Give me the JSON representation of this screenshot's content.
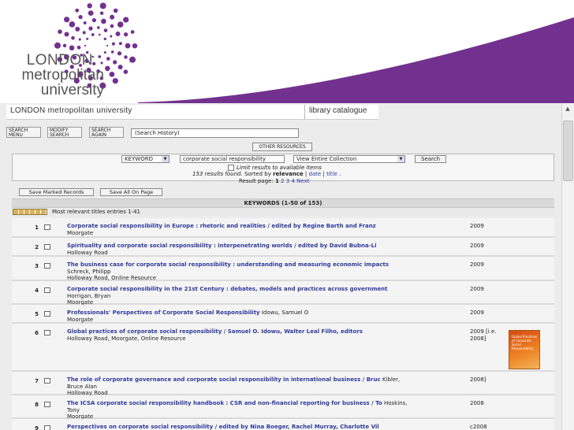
{
  "logo": {
    "line1": "LONDON",
    "line2": "metropolitan",
    "line3": "university",
    "accent": "#73318f"
  },
  "banner": {
    "left": "LONDON metropolitan university",
    "right": "library catalogue"
  },
  "nav": {
    "search_menu": [
      "SEARCH",
      "MENU"
    ],
    "modify_search": [
      "MODIFY",
      "SEARCH"
    ],
    "search_again": [
      "SEARCH",
      "AGAIN"
    ],
    "history": "(Search History)",
    "other_resources": "OTHER RESOURCES"
  },
  "search": {
    "field": "KEYWORD",
    "query": "corporate social responsibility",
    "collection": "View Entire Collection",
    "button": "Search",
    "limit": "Limit results to available items",
    "results_prefix": "153 results found.",
    "sorted_by": "Sorted by",
    "relevance": "relevance",
    "sep1": "|",
    "date": "date",
    "sep2": "|",
    "title": "title",
    "tail": ".",
    "page_label": "Result page:",
    "pages": [
      "1",
      "2",
      "3",
      "4"
    ],
    "next": "Next"
  },
  "actions": {
    "save_marked": "Save Marked Records",
    "save_all": "Save All On Page"
  },
  "keywords_bar": "KEYWORDS (1-50 of 153)",
  "entries_label": "Most relevant titles entries 1-41",
  "results": [
    {
      "num": "1",
      "title": "Corporate social responsibility in Europe : rhetoric and realities / edited by Regine Barth and Franz",
      "author": "",
      "details": [
        "Moorgate"
      ],
      "year": "2009"
    },
    {
      "num": "2",
      "title": "Spirituality and corporate social responsibility : interpenetrating worlds / edited by David Bubna-Li",
      "author": "",
      "details": [
        "Holloway Road"
      ],
      "year": "2009"
    },
    {
      "num": "3",
      "title": "The business case for corporate social responsibility : understanding and measuring economic impacts",
      "author": "",
      "details": [
        "Schreck, Philipp",
        "Holloway Road, Online Resource"
      ],
      "year": "2009"
    },
    {
      "num": "4",
      "title": "Corporate social responsibility in the 21st Century : debates, models and practices across government",
      "author": "",
      "details": [
        "Horrigan, Bryan",
        "Moorgate"
      ],
      "year": "2009"
    },
    {
      "num": "5",
      "title": "Professionals' Perspectives of Corporate Social Responsibility",
      "author": "Idowu, Samuel O",
      "details": [
        "Moorgate"
      ],
      "year": "2009"
    },
    {
      "num": "6",
      "title": "Global practices of corporate social responsibility / Samuel O. Idowu, Walter Leal Filho, editors",
      "author": "",
      "details": [
        "Holloway Road, Moorgate, Online Resource"
      ],
      "year": "2009 [i.e. 2008]",
      "cover": "Global Practices of Corporate Social Responsibility"
    },
    {
      "num": "7",
      "title": "The role of corporate governance and corporate social responsibility in international business / Bruc",
      "author": "Kibler,",
      "details": [
        "Bruce Alan",
        "Holloway Road"
      ],
      "year": "2008]"
    },
    {
      "num": "8",
      "title": "The ICSA corporate social responsibility handbook : CSR and non-financial reporting for business / To",
      "author": "Hoskins,",
      "details": [
        "Tony",
        "Moorgate"
      ],
      "year": "2008"
    },
    {
      "num": "9",
      "title": "Perspectives on corporate social responsibility / edited by Nina Boeger, Rachel Murray, Charlotte Vil",
      "author": "",
      "details": [],
      "year": "c2008"
    }
  ]
}
